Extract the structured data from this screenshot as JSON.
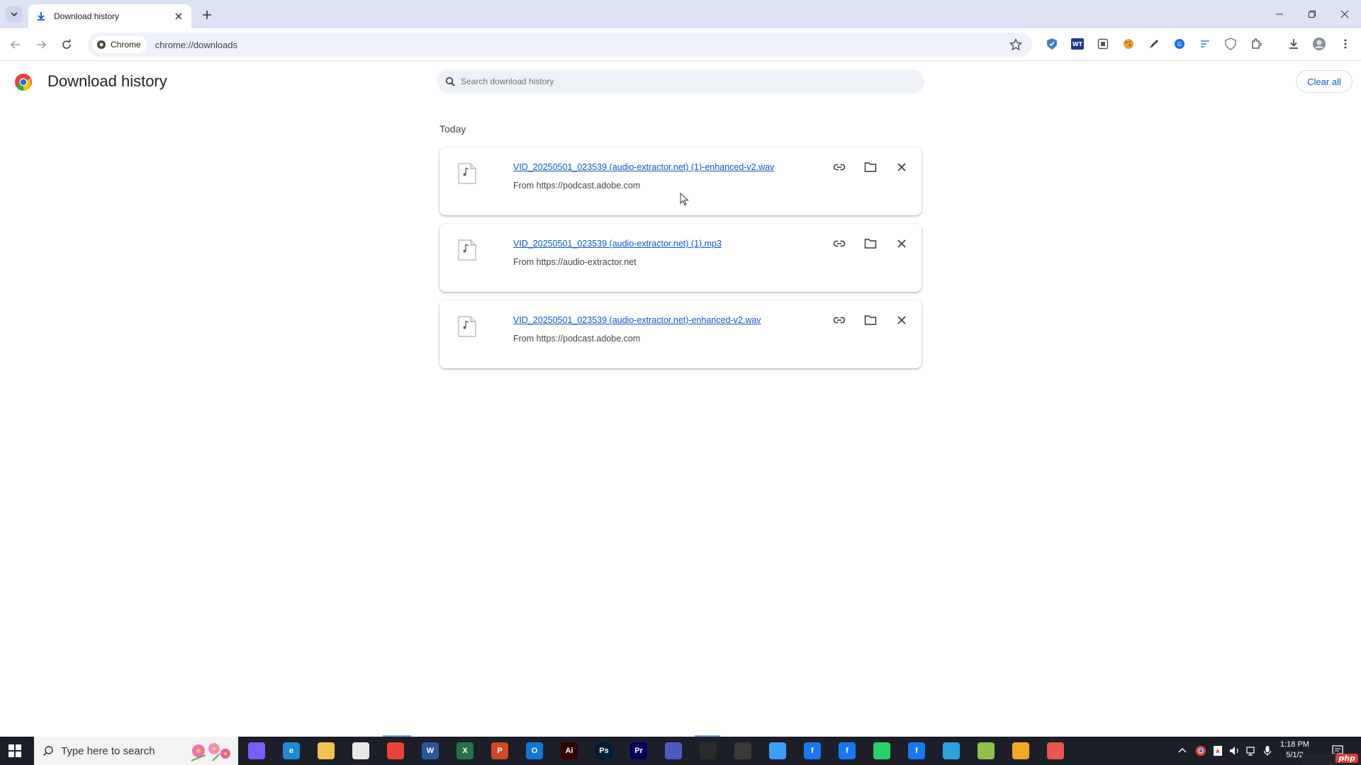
{
  "browser": {
    "tab": {
      "title": "Download history"
    },
    "omnibox": {
      "chip_label": "Chrome",
      "url": "chrome://downloads"
    }
  },
  "page": {
    "title": "Download history",
    "search_placeholder": "Search download history",
    "clear_all_label": "Clear all",
    "section_label": "Today"
  },
  "downloads": [
    {
      "filename": "VID_20250501_023539 (audio-extractor.net) (1)-enhanced-v2.wav",
      "source": "From https://podcast.adobe.com",
      "type_label": "WAV"
    },
    {
      "filename": "VID_20250501_023539 (audio-extractor.net) (1).mp3",
      "source": "From https://audio-extractor.net",
      "type_label": "MP3"
    },
    {
      "filename": "VID_20250501_023539 (audio-extractor.net)-enhanced-v2.wav",
      "source": "From https://podcast.adobe.com",
      "type_label": "WAV"
    }
  ],
  "taskbar": {
    "search_placeholder": "Type here to search",
    "clock_time": "1:18 PM",
    "clock_date": "5/1/2",
    "apps": [
      {
        "name": "copilot",
        "label": "",
        "color": "#7b5cff"
      },
      {
        "name": "edge",
        "label": "e",
        "color": "#1a8bd6"
      },
      {
        "name": "file-explorer",
        "label": "",
        "color": "#f2c14e"
      },
      {
        "name": "store",
        "label": "",
        "color": "#e8e8e8"
      },
      {
        "name": "chrome",
        "label": "",
        "color": "#ea4335"
      },
      {
        "name": "word",
        "label": "W",
        "color": "#2b579a"
      },
      {
        "name": "excel",
        "label": "X",
        "color": "#217346"
      },
      {
        "name": "powerpoint",
        "label": "P",
        "color": "#d24726"
      },
      {
        "name": "outlook",
        "label": "O",
        "color": "#0f78d4"
      },
      {
        "name": "illustrator",
        "label": "Ai",
        "color": "#330000"
      },
      {
        "name": "photoshop",
        "label": "Ps",
        "color": "#001e36"
      },
      {
        "name": "premiere",
        "label": "Pr",
        "color": "#00005b"
      },
      {
        "name": "app-13",
        "label": "",
        "color": "#4a5cc4"
      },
      {
        "name": "app-14",
        "label": "",
        "color": "#2a2a2a"
      },
      {
        "name": "app-15",
        "label": "",
        "color": "#3a3a3a"
      },
      {
        "name": "app-16",
        "label": "",
        "color": "#3aa0ff"
      },
      {
        "name": "facebook-1",
        "label": "f",
        "color": "#1877f2"
      },
      {
        "name": "facebook-2",
        "label": "f",
        "color": "#1877f2"
      },
      {
        "name": "whatsapp",
        "label": "",
        "color": "#25d366"
      },
      {
        "name": "facebook-3",
        "label": "f",
        "color": "#1877f2"
      },
      {
        "name": "telegram",
        "label": "",
        "color": "#2aa3df"
      },
      {
        "name": "notepad",
        "label": "",
        "color": "#8bc34a"
      },
      {
        "name": "app-23",
        "label": "",
        "color": "#f5a623"
      },
      {
        "name": "app-24",
        "label": "",
        "color": "#e8574a"
      }
    ]
  },
  "colors": {
    "link": "#0b57d0",
    "tabstrip": "#dde3f5",
    "taskbar": "#1c1f27"
  }
}
